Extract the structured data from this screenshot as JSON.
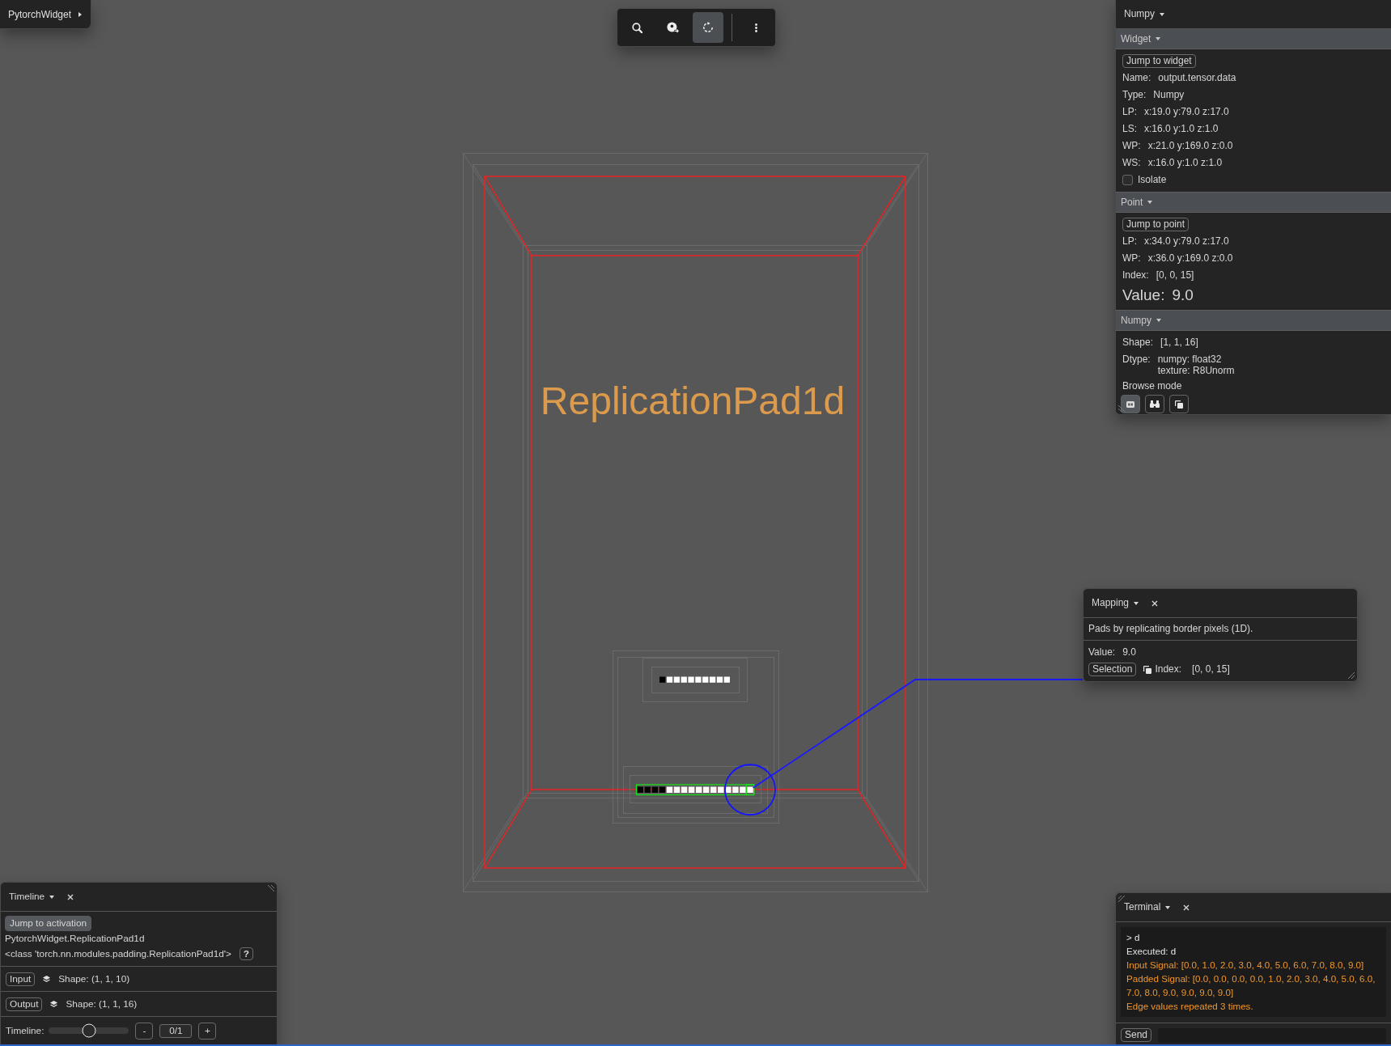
{
  "app_menu": {
    "label": "PytorchWidget"
  },
  "toolbar": {
    "tools": [
      {
        "selected": false
      },
      {
        "selected": false
      },
      {
        "selected": true
      },
      {
        "selected": false
      }
    ]
  },
  "viewport": {
    "title": "ReplicationPad1d",
    "input_tensor": {
      "selected": false,
      "cells": [
        {
          "color": "#000000",
          "selected": false
        },
        {
          "color": "#ffffff",
          "selected": false
        },
        {
          "color": "#ffffff",
          "selected": false
        },
        {
          "color": "#ffffff",
          "selected": false
        },
        {
          "color": "#ffffff",
          "selected": false
        },
        {
          "color": "#ffffff",
          "selected": false
        },
        {
          "color": "#ffffff",
          "selected": false
        },
        {
          "color": "#ffffff",
          "selected": false
        },
        {
          "color": "#ffffff",
          "selected": false
        },
        {
          "color": "#ffffff",
          "selected": false
        }
      ]
    },
    "output_tensor": {
      "selected": true,
      "cells": [
        {
          "color": "#000000",
          "selected": false
        },
        {
          "color": "#000000",
          "selected": false
        },
        {
          "color": "#000000",
          "selected": false
        },
        {
          "color": "#000000",
          "selected": false
        },
        {
          "color": "#ffffff",
          "selected": false
        },
        {
          "color": "#ffffff",
          "selected": false
        },
        {
          "color": "#ffffff",
          "selected": false
        },
        {
          "color": "#ffffff",
          "selected": false
        },
        {
          "color": "#ffffff",
          "selected": false
        },
        {
          "color": "#ffffff",
          "selected": false
        },
        {
          "color": "#ffffff",
          "selected": false
        },
        {
          "color": "#ffffff",
          "selected": false
        },
        {
          "color": "#ffffff",
          "selected": false
        },
        {
          "color": "#ffffff",
          "selected": false
        },
        {
          "color": "#ffffff",
          "selected": false
        },
        {
          "color": "#ffffff",
          "selected": true
        }
      ]
    }
  },
  "inspector": {
    "title": "Numpy",
    "sections": [
      {
        "title": "Widget",
        "expanded": true,
        "rows": [
          {
            "kind": "button",
            "label": "Jump to widget"
          },
          {
            "kind": "field",
            "label": "Name:",
            "value": "output.tensor.data"
          },
          {
            "kind": "field",
            "label": "Type:",
            "value": "Numpy"
          },
          {
            "kind": "field",
            "label": "LP:",
            "value": "x:19.0 y:79.0 z:17.0"
          },
          {
            "kind": "field",
            "label": "LS:",
            "value": "x:16.0 y:1.0 z:1.0"
          },
          {
            "kind": "field",
            "label": "WP:",
            "value": "x:21.0 y:169.0 z:0.0"
          },
          {
            "kind": "field",
            "label": "WS:",
            "value": "x:16.0 y:1.0 z:1.0"
          },
          {
            "kind": "checkbox",
            "label": "Isolate",
            "checked": false
          }
        ]
      },
      {
        "title": "Point",
        "expanded": true,
        "rows": [
          {
            "kind": "button",
            "label": "Jump to point"
          },
          {
            "kind": "field",
            "label": "LP:",
            "value": "x:34.0 y:79.0 z:17.0"
          },
          {
            "kind": "field",
            "label": "WP:",
            "value": "x:36.0 y:169.0 z:0.0"
          },
          {
            "kind": "field",
            "label": "Index:",
            "value": "[0, 0, 15]"
          },
          {
            "kind": "value",
            "label": "Value:",
            "value": "9.0"
          }
        ]
      },
      {
        "title": "Numpy",
        "expanded": true,
        "rows": [
          {
            "kind": "field",
            "label": "Shape:",
            "value": "[1, 1, 16]"
          },
          {
            "kind": "multiline",
            "label": "Dtype:",
            "lines": [
              "numpy: float32",
              "texture: R8Unorm"
            ]
          },
          {
            "kind": "heading",
            "label": "Browse mode"
          },
          {
            "kind": "modes",
            "options": [
              {
                "selected": true
              },
              {
                "selected": false
              },
              {
                "selected": false
              }
            ]
          }
        ]
      }
    ]
  },
  "mapping": {
    "title": "Mapping",
    "description": "Pads by replicating border pixels (1D).",
    "value": {
      "label": "Value:",
      "value": "9.0"
    },
    "selection_button": "Selection",
    "index": {
      "label": "Index:",
      "value": "[0, 0, 15]"
    }
  },
  "timeline_panel": {
    "title": "Timeline",
    "jump_button": "Jump to activation",
    "module_path": "PytorchWidget.ReplicationPad1d",
    "module_class": "<class 'torch.nn.modules.padding.ReplicationPad1d'>",
    "help_button": "?",
    "tensors": [
      {
        "button": "Input",
        "shape": "Shape: (1, 1, 10)"
      },
      {
        "button": "Output",
        "shape": "Shape: (1, 1, 16)"
      }
    ],
    "slider": {
      "label": "Timeline:",
      "level": 0.5
    },
    "decrement": "-",
    "step": "0/1",
    "increment": "+"
  },
  "terminal": {
    "title": "Terminal",
    "lines": [
      {
        "kind": "command",
        "text": "> d"
      },
      {
        "kind": "info",
        "text": "Executed: d"
      },
      {
        "kind": "result",
        "text": "Input Signal: [0.0, 1.0, 2.0, 3.0, 4.0, 5.0, 6.0, 7.0, 8.0, 9.0]"
      },
      {
        "kind": "result",
        "text": "Padded Signal: [0.0, 0.0, 0.0, 0.0, 1.0, 2.0, 3.0, 4.0, 5.0, 6.0, 7.0, 8.0, 9.0, 9.0, 9.0, 9.0]"
      },
      {
        "kind": "result",
        "text": "Edge values repeated 3 times."
      }
    ],
    "send_button": "Send"
  }
}
